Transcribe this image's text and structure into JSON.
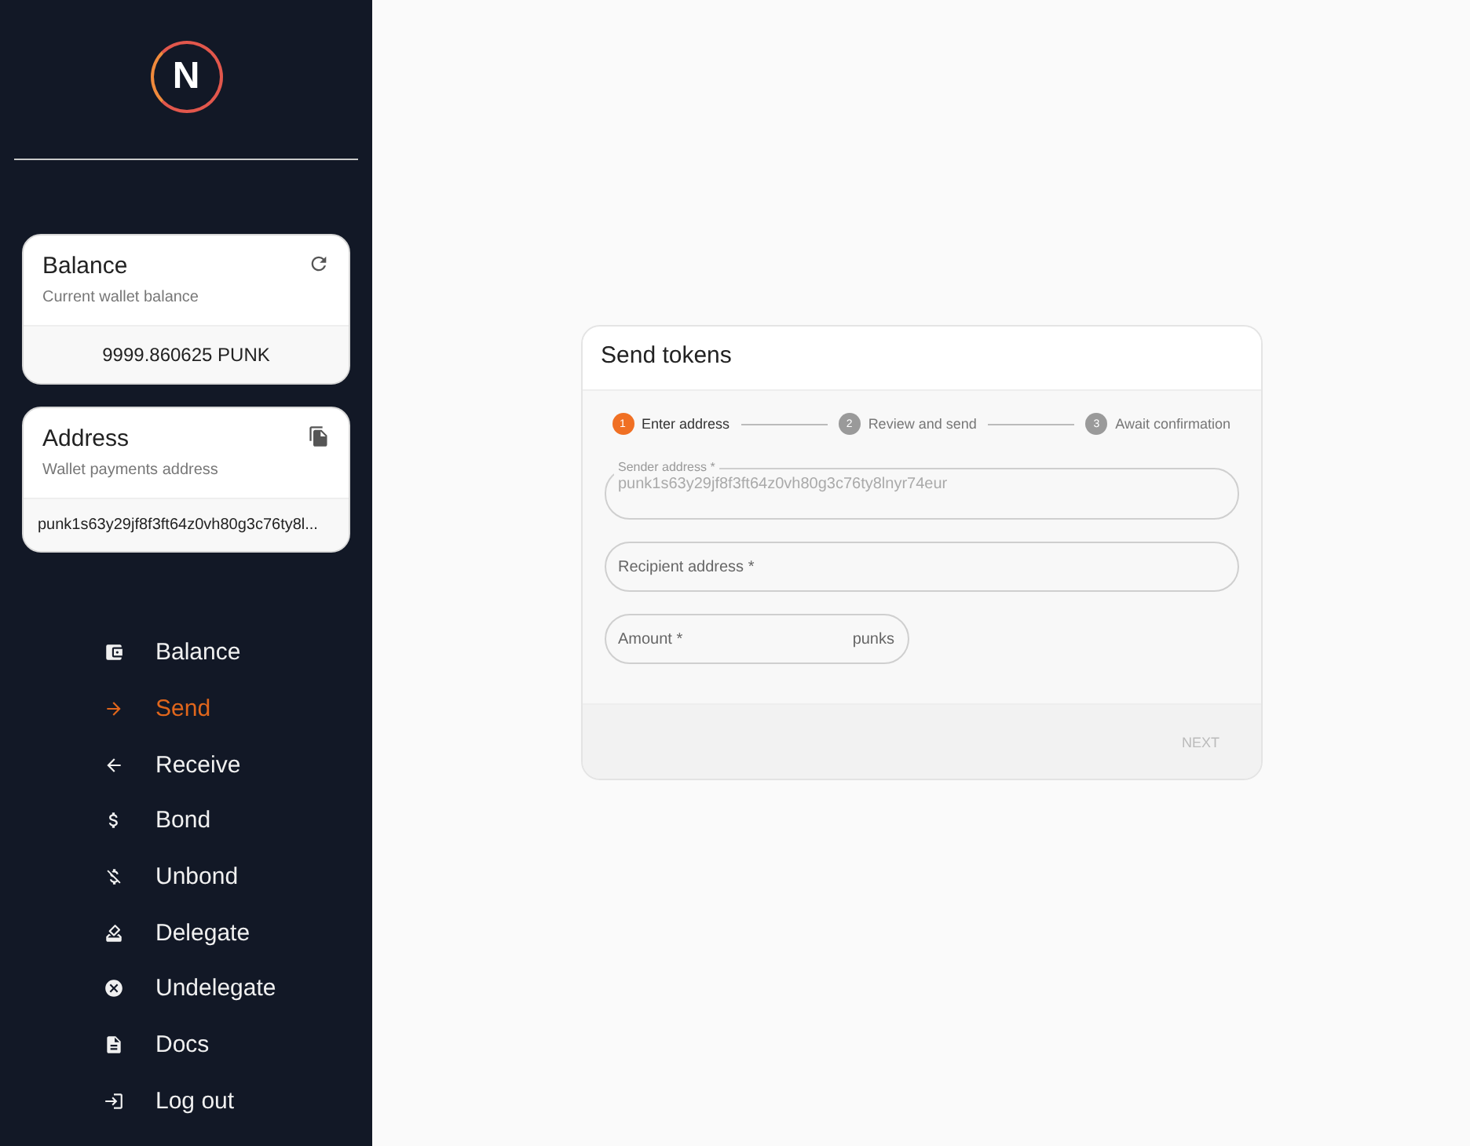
{
  "logo": {
    "letter": "N"
  },
  "balance_card": {
    "title": "Balance",
    "subtitle": "Current wallet balance",
    "value": "9999.860625 PUNK"
  },
  "address_card": {
    "title": "Address",
    "subtitle": "Wallet payments address",
    "value": "punk1s63y29jf8f3ft64z0vh80g3c76ty8l..."
  },
  "nav": [
    {
      "label": "Balance",
      "kind": "wallet",
      "selected": false
    },
    {
      "label": "Send",
      "kind": "send",
      "selected": true
    },
    {
      "label": "Receive",
      "kind": "receive",
      "selected": false
    },
    {
      "label": "Bond",
      "kind": "bond",
      "selected": false
    },
    {
      "label": "Unbond",
      "kind": "unbond",
      "selected": false
    },
    {
      "label": "Delegate",
      "kind": "delegate",
      "selected": false
    },
    {
      "label": "Undelegate",
      "kind": "undelegate",
      "selected": false
    },
    {
      "label": "Docs",
      "kind": "docs",
      "selected": false
    },
    {
      "label": "Log out",
      "kind": "logout",
      "selected": false
    }
  ],
  "send_form": {
    "title": "Send tokens",
    "steps": [
      {
        "number": "1",
        "label": "Enter address",
        "selected": true
      },
      {
        "number": "2",
        "label": "Review and send",
        "selected": false
      },
      {
        "number": "3",
        "label": "Await confirmation",
        "selected": false
      }
    ],
    "sender": {
      "label": "Sender address *",
      "value": "punk1s63y29jf8f3ft64z0vh80g3c76ty8lnyr74eur",
      "disabled": true
    },
    "recipient": {
      "label": "Recipient address *"
    },
    "amount": {
      "label": "Amount *",
      "unit": "punks"
    },
    "next_button": {
      "label": "NEXT",
      "disabled": true
    }
  }
}
